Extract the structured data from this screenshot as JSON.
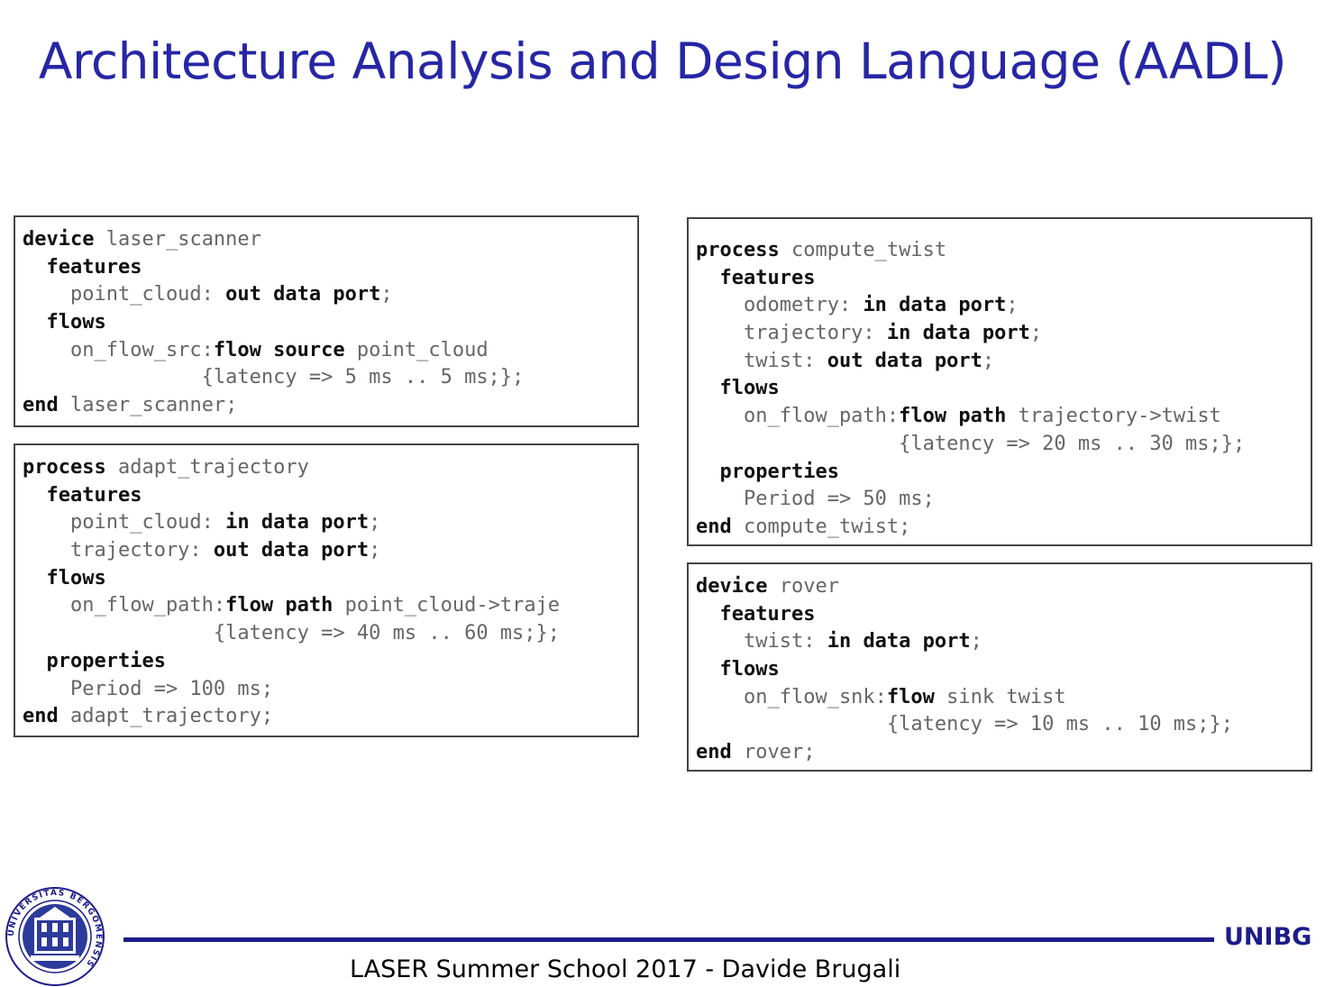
{
  "slide": {
    "title": "Architecture Analysis and Design Language (AADL)",
    "footer_text": "LASER Summer School 2017 - Davide Brugali",
    "brand": "UNIBG"
  },
  "colors": {
    "title": "#2626a6",
    "rule": "#1c1c8a",
    "border": "#444444"
  },
  "seal": {
    "icon": "university-seal-icon",
    "ring_text": "UNIVERSITAS BERGOMENSIS"
  },
  "boxes": [
    {
      "name": "laser-scanner",
      "lines": [
        [
          [
            "kw",
            "device"
          ],
          [
            "id",
            " laser_scanner"
          ]
        ],
        [
          [
            "id",
            "  "
          ],
          [
            "kw",
            "features"
          ]
        ],
        [
          [
            "id",
            "    point_cloud: "
          ],
          [
            "kw",
            "out data port"
          ],
          [
            "id",
            ";"
          ]
        ],
        [
          [
            "id",
            "  "
          ],
          [
            "kw",
            "flows"
          ]
        ],
        [
          [
            "id",
            "    on_flow_src:"
          ],
          [
            "kw",
            "flow source"
          ],
          [
            "id",
            " point_cloud"
          ]
        ],
        [
          [
            "id",
            "               {latency => 5 ms .. 5 ms;};"
          ]
        ],
        [
          [
            "kw",
            "end"
          ],
          [
            "id",
            " laser_scanner;"
          ]
        ]
      ]
    },
    {
      "name": "adapt-trajectory",
      "lines": [
        [
          [
            "kw",
            "process"
          ],
          [
            "id",
            " adapt_trajectory"
          ]
        ],
        [
          [
            "id",
            "  "
          ],
          [
            "kw",
            "features"
          ]
        ],
        [
          [
            "id",
            "    point_cloud: "
          ],
          [
            "kw",
            "in data port"
          ],
          [
            "id",
            ";"
          ]
        ],
        [
          [
            "id",
            "    trajectory: "
          ],
          [
            "kw",
            "out data port"
          ],
          [
            "id",
            ";"
          ]
        ],
        [
          [
            "id",
            "  "
          ],
          [
            "kw",
            "flows"
          ]
        ],
        [
          [
            "id",
            "    on_flow_path:"
          ],
          [
            "kw",
            "flow path"
          ],
          [
            "id",
            " point_cloud->traje"
          ]
        ],
        [
          [
            "id",
            "                {latency => 40 ms .. 60 ms;};"
          ]
        ],
        [
          [
            "id",
            "  "
          ],
          [
            "kw",
            "properties"
          ]
        ],
        [
          [
            "id",
            "    Period => 100 ms;"
          ]
        ],
        [
          [
            "kw",
            "end"
          ],
          [
            "id",
            " adapt_trajectory;"
          ]
        ]
      ]
    },
    {
      "name": "compute-twist",
      "lines": [
        [
          [
            "kw",
            "process"
          ],
          [
            "id",
            " compute_twist"
          ]
        ],
        [
          [
            "id",
            "  "
          ],
          [
            "kw",
            "features"
          ]
        ],
        [
          [
            "id",
            "    odometry: "
          ],
          [
            "kw",
            "in data port"
          ],
          [
            "id",
            ";"
          ]
        ],
        [
          [
            "id",
            "    trajectory: "
          ],
          [
            "kw",
            "in data port"
          ],
          [
            "id",
            ";"
          ]
        ],
        [
          [
            "id",
            "    twist: "
          ],
          [
            "kw",
            "out data port"
          ],
          [
            "id",
            ";"
          ]
        ],
        [
          [
            "id",
            "  "
          ],
          [
            "kw",
            "flows"
          ]
        ],
        [
          [
            "id",
            "    on_flow_path:"
          ],
          [
            "kw",
            "flow path"
          ],
          [
            "id",
            " trajectory->twist"
          ]
        ],
        [
          [
            "id",
            "                 {latency => 20 ms .. 30 ms;};"
          ]
        ],
        [
          [
            "id",
            "  "
          ],
          [
            "kw",
            "properties"
          ]
        ],
        [
          [
            "id",
            "    Period => 50 ms;"
          ]
        ],
        [
          [
            "kw",
            "end"
          ],
          [
            "id",
            " compute_twist;"
          ]
        ]
      ]
    },
    {
      "name": "rover",
      "lines": [
        [
          [
            "kw",
            "device"
          ],
          [
            "id",
            " rover"
          ]
        ],
        [
          [
            "id",
            "  "
          ],
          [
            "kw",
            "features"
          ]
        ],
        [
          [
            "id",
            "    twist: "
          ],
          [
            "kw",
            "in data port"
          ],
          [
            "id",
            ";"
          ]
        ],
        [
          [
            "id",
            "  "
          ],
          [
            "kw",
            "flows"
          ]
        ],
        [
          [
            "id",
            "    on_flow_snk:"
          ],
          [
            "kw",
            "flow"
          ],
          [
            "id",
            " sink twist"
          ]
        ],
        [
          [
            "id",
            "                {latency => 10 ms .. 10 ms;};"
          ]
        ],
        [
          [
            "kw",
            "end"
          ],
          [
            "id",
            " rover;"
          ]
        ]
      ]
    }
  ]
}
